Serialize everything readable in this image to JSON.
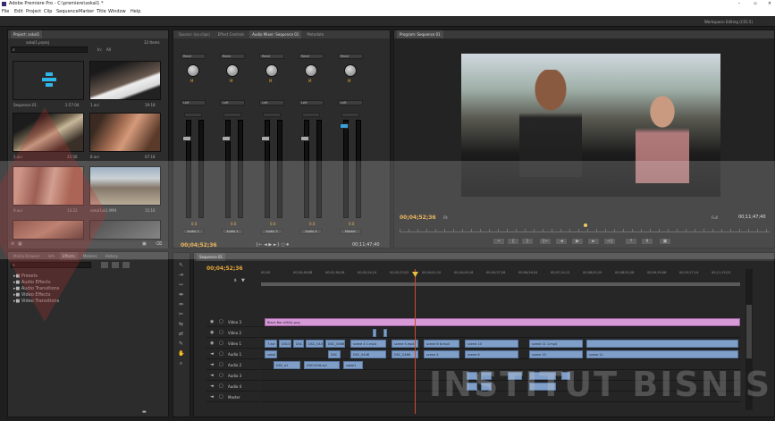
{
  "window": {
    "title": "Adobe Premiere Pro - C:\\premiere\\sokal1 *"
  },
  "menu": [
    "File",
    "Edit",
    "Project",
    "Clip",
    "Sequence",
    "Marker",
    "Title",
    "Window",
    "Help"
  ],
  "workspace": {
    "label": "Workspace:",
    "value": "Editing (CS5.5)"
  },
  "project": {
    "tabs": [
      "Project: sokal1",
      "Media Browser",
      "Info",
      "Effects",
      "Markers",
      "History"
    ],
    "file_name": "sokal1.prproj",
    "items_count": "32 Items",
    "search_placeholder": "",
    "in_label": "In:",
    "in_value": "All",
    "clips": [
      {
        "name": "Sequence 01",
        "duration": "2:57:04"
      },
      {
        "name": "1.avi",
        "duration": "19:18"
      },
      {
        "name": "2.avi",
        "duration": "25:56"
      },
      {
        "name": "8.avi",
        "duration": "07:18"
      },
      {
        "name": "9.avi",
        "duration": "13:22"
      },
      {
        "name": "sokal1sk1.MP4",
        "duration": "15:16"
      }
    ]
  },
  "effects": {
    "folders": [
      "Presets",
      "Audio Effects",
      "Audio Transitions",
      "Video Effects",
      "Video Transitions"
    ]
  },
  "mixer": {
    "tabs": [
      "Source: (no clips)",
      "Effect Controls",
      "Audio Mixer: Sequence 01",
      "Metadata"
    ],
    "channels": [
      {
        "read": "Read",
        "pan": "Left",
        "name": "Audio 1"
      },
      {
        "read": "Read",
        "pan": "Left",
        "name": "Audio 2"
      },
      {
        "read": "Read",
        "pan": "Left",
        "name": "Audio 3"
      },
      {
        "read": "Read",
        "pan": "Left",
        "name": "Audio 4"
      },
      {
        "read": "Read",
        "pan": "Left",
        "name": "Master"
      }
    ],
    "timecode": "00;04;52;36",
    "duration": "00;11;47;40"
  },
  "program": {
    "tab": "Program: Sequence 01",
    "timecode": "00;04;52;36",
    "fit": "Fit",
    "zoom": "Full",
    "duration": "00;11;47;40"
  },
  "timeline": {
    "tab": "Sequence 01",
    "timecode": "00;04;52;36",
    "ruler": [
      "00;00",
      "00;00;48;08",
      "00;01;36;16",
      "00;02;24;24",
      "00;03;13;02",
      "00;04;01;10",
      "00;04;49;18",
      "00;05;37;26",
      "00;06;26;04",
      "00;07;14;12",
      "00;08;02;20",
      "00;08;50;28",
      "00;09;39;06",
      "00;10;27;14",
      "00;11;15;22"
    ],
    "tracks": [
      "Video 3",
      "Video 2",
      "Video 1",
      "Audio 1",
      "Audio 2",
      "Audio 3",
      "Audio 4",
      "Master"
    ],
    "title_clip": "Black Bar sOKAL.png",
    "clips_v1": [
      "7.avi",
      "DSC0",
      "DSC",
      "DSC_0446",
      "DSC_0466",
      "scene 4 1.mp4",
      "scene 5.mp4",
      "scene 6 8.mp4",
      "scene 10",
      "scene 11 1.mp4"
    ],
    "clips_a1": [
      "sokal",
      "DSC",
      "DSC_0446",
      "DSC_0466",
      "scene 4",
      "scene 6",
      "scene 10",
      "scene 11"
    ],
    "clips_a2": [
      "DSC_a1",
      "DSC0016.avi",
      "sokal1"
    ]
  },
  "watermark": "INSTITUT BISNIS"
}
